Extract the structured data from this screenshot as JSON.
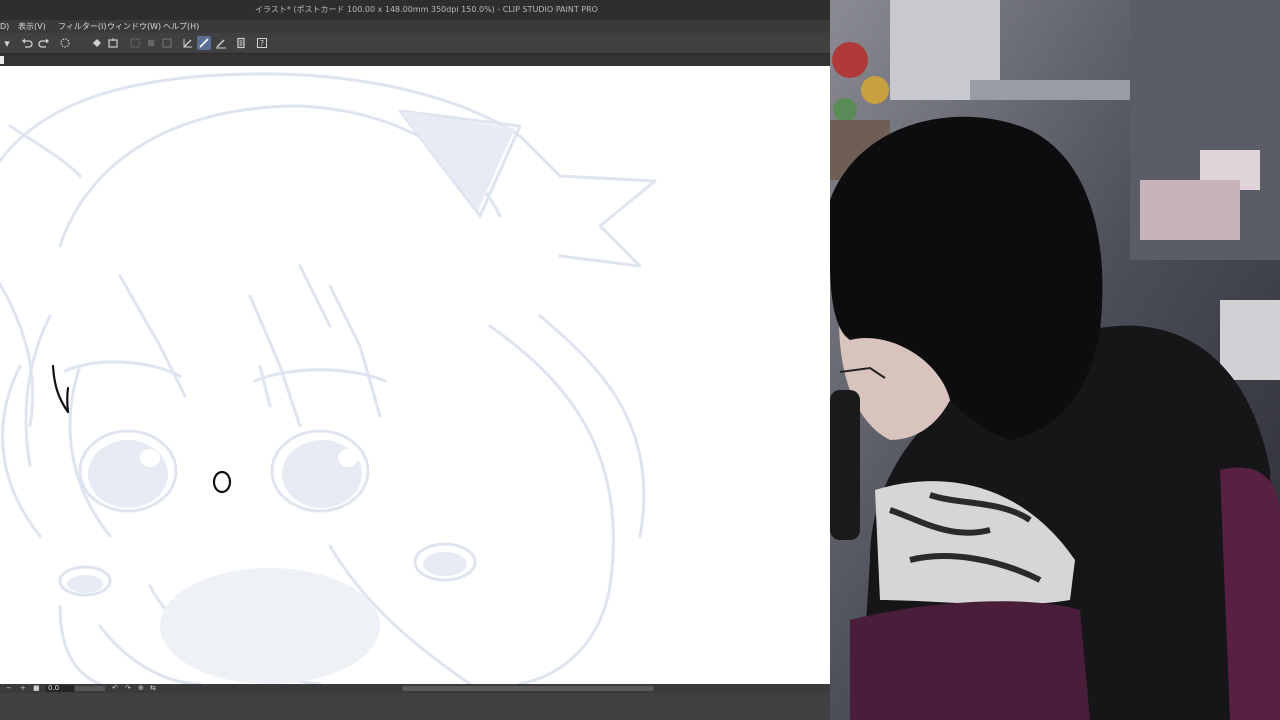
{
  "window": {
    "title": "イラスト* (ポストカード 100.00 x 148.00mm 350dpi 150.0%)  - CLIP STUDIO PAINT PRO"
  },
  "menu": {
    "items": [
      {
        "label": "D)"
      },
      {
        "label": "表示(V)"
      },
      {
        "label": "フィルター(I)"
      },
      {
        "label": "ウィンドウ(W)"
      },
      {
        "label": "ヘルプ(H)"
      }
    ]
  },
  "toolbar": {
    "icons": [
      "dropdown-icon",
      "undo-icon",
      "redo-icon",
      "loading-icon",
      "fill-icon",
      "transform-icon",
      "select-icon",
      "crop-icon",
      "mask-icon",
      "pen-icon",
      "active-pen-icon",
      "ruler-icon",
      "clipboard-icon",
      "help-icon"
    ]
  },
  "status": {
    "minus": "−",
    "plus": "+",
    "zoom_value": "0.0"
  },
  "colors": {
    "canvas": "#ffffff",
    "sketch": "#dce3ef",
    "sketch_fill": "#e6ebf3",
    "ink": "#111111",
    "ui_dark": "#3c3c3c",
    "active_tool": "#5b6e93"
  }
}
